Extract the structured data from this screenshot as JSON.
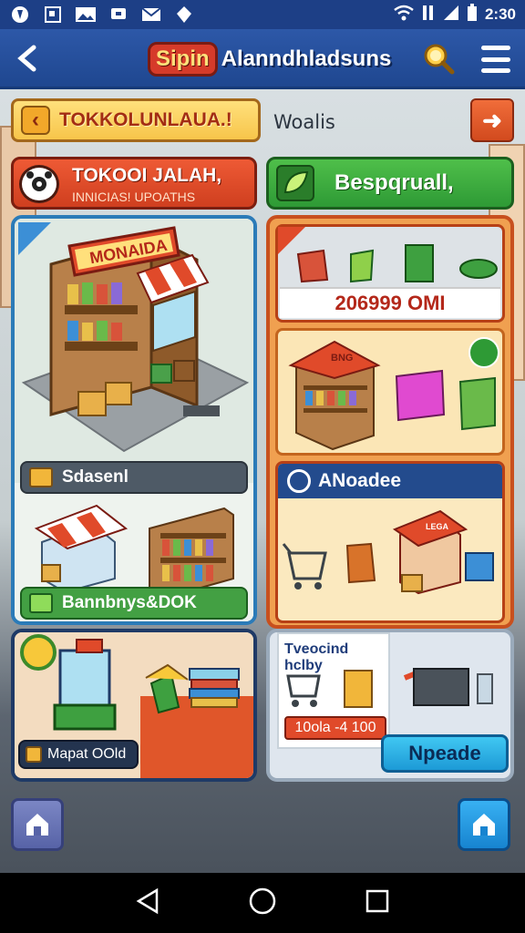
{
  "status_bar": {
    "time": "2:30",
    "icons": [
      "app-icon",
      "image-icon",
      "photo-icon",
      "message-icon",
      "mail-icon",
      "location-icon",
      "wifi-icon",
      "mute-icon",
      "signal-icon",
      "battery-icon"
    ]
  },
  "header": {
    "title_badge": "Sipin",
    "title_rest": "Alanndhladsuns",
    "icons": [
      "back-icon",
      "search-icon",
      "menu-icon"
    ]
  },
  "top": {
    "banner": "TOKKOLUNLAUA.!",
    "world_label": "Woalis"
  },
  "left_header": {
    "title": "TOKOOI JALAH,",
    "subtitle": "INNICIAS! UPOATHS"
  },
  "right_header": {
    "title": "Bespqruall,"
  },
  "store_panel": {
    "sign": "MONAIDA",
    "mid_label": "Sdasenl",
    "bottom_label": "Bannbnys&DOK"
  },
  "right_panel": {
    "price": "206999 OMI",
    "mid_sign": "BNG",
    "shop_title": "ANoadee",
    "shop_sign": "LEGA"
  },
  "bottom_left": {
    "label": "Mapat OOld"
  },
  "bottom_right": {
    "promo_title": "Tveocind hclby",
    "promo_price": "10ola -4 100",
    "upgrade_button": "Npeade"
  },
  "colors": {
    "status_bar": "#1d3f86",
    "app_bar": "#2d58a8",
    "accent_red": "#d63b2a",
    "accent_green": "#2e9a35",
    "accent_blue": "#1d9ad6"
  }
}
